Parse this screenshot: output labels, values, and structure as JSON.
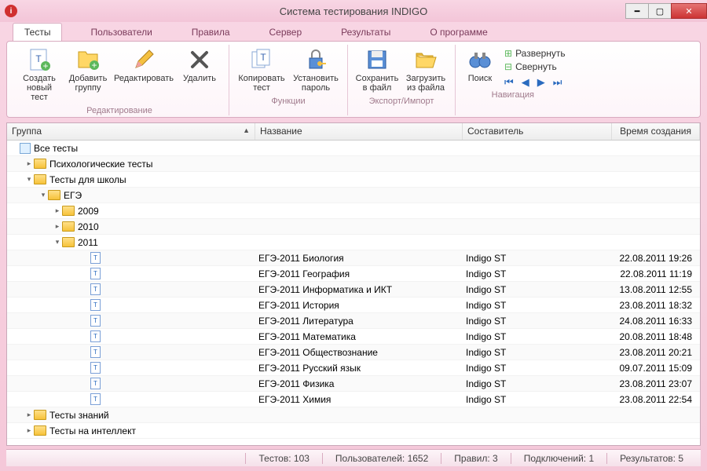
{
  "window": {
    "title": "Система тестирования INDIGO"
  },
  "tabs": [
    "Тесты",
    "Пользователи",
    "Правила",
    "Сервер",
    "Результаты",
    "О программе"
  ],
  "ribbon": {
    "groups": [
      {
        "label": "Редактирование",
        "items": [
          {
            "label": "Создать\nновый тест"
          },
          {
            "label": "Добавить\nгруппу"
          },
          {
            "label": "Редактировать"
          },
          {
            "label": "Удалить"
          }
        ]
      },
      {
        "label": "Функции",
        "items": [
          {
            "label": "Копировать\nтест"
          },
          {
            "label": "Установить\nпароль"
          }
        ]
      },
      {
        "label": "Экспорт/Импорт",
        "items": [
          {
            "label": "Сохранить\nв файл"
          },
          {
            "label": "Загрузить\nиз файла"
          }
        ]
      },
      {
        "label": "Навигация",
        "items": [
          {
            "label": "Поиск"
          }
        ],
        "links": {
          "expand": "Развернуть",
          "collapse": "Свернуть"
        }
      }
    ]
  },
  "columns": {
    "group": "Группа",
    "name": "Название",
    "author": "Составитель",
    "date": "Время создания"
  },
  "tree": {
    "root": "Все тесты",
    "nodes": [
      {
        "label": "Психологические тесты",
        "exp": "▸"
      },
      {
        "label": "Тесты для школы",
        "exp": "▾"
      },
      {
        "label": "ЕГЭ",
        "exp": "▾",
        "indent": 2
      },
      {
        "label": "2009",
        "exp": "▸",
        "indent": 3
      },
      {
        "label": "2010",
        "exp": "▸",
        "indent": 3
      },
      {
        "label": "2011",
        "exp": "▾",
        "indent": 3
      }
    ],
    "tests": [
      {
        "name": "ЕГЭ-2011 Биология",
        "author": "Indigo ST",
        "date": "22.08.2011 19:26"
      },
      {
        "name": "ЕГЭ-2011 География",
        "author": "Indigo ST",
        "date": "22.08.2011 11:19"
      },
      {
        "name": "ЕГЭ-2011 Информатика и ИКТ",
        "author": "Indigo ST",
        "date": "13.08.2011 12:55"
      },
      {
        "name": "ЕГЭ-2011 История",
        "author": "Indigo ST",
        "date": "23.08.2011 18:32"
      },
      {
        "name": "ЕГЭ-2011 Литература",
        "author": "Indigo ST",
        "date": "24.08.2011 16:33"
      },
      {
        "name": "ЕГЭ-2011 Математика",
        "author": "Indigo ST",
        "date": "20.08.2011 18:48"
      },
      {
        "name": "ЕГЭ-2011 Обществознание",
        "author": "Indigo ST",
        "date": "23.08.2011 20:21"
      },
      {
        "name": "ЕГЭ-2011 Русский язык",
        "author": "Indigo ST",
        "date": "09.07.2011 15:09"
      },
      {
        "name": "ЕГЭ-2011 Физика",
        "author": "Indigo ST",
        "date": "23.08.2011 23:07"
      },
      {
        "name": "ЕГЭ-2011 Химия",
        "author": "Indigo ST",
        "date": "23.08.2011 22:54"
      }
    ],
    "tail": [
      {
        "label": "Тесты знаний",
        "exp": "▸"
      },
      {
        "label": "Тесты на интеллект",
        "exp": "▸"
      }
    ]
  },
  "status": {
    "tests": "Тестов: 103",
    "users": "Пользователей: 1652",
    "rules": "Правил: 3",
    "connections": "Подключений: 1",
    "results": "Результатов: 5"
  }
}
